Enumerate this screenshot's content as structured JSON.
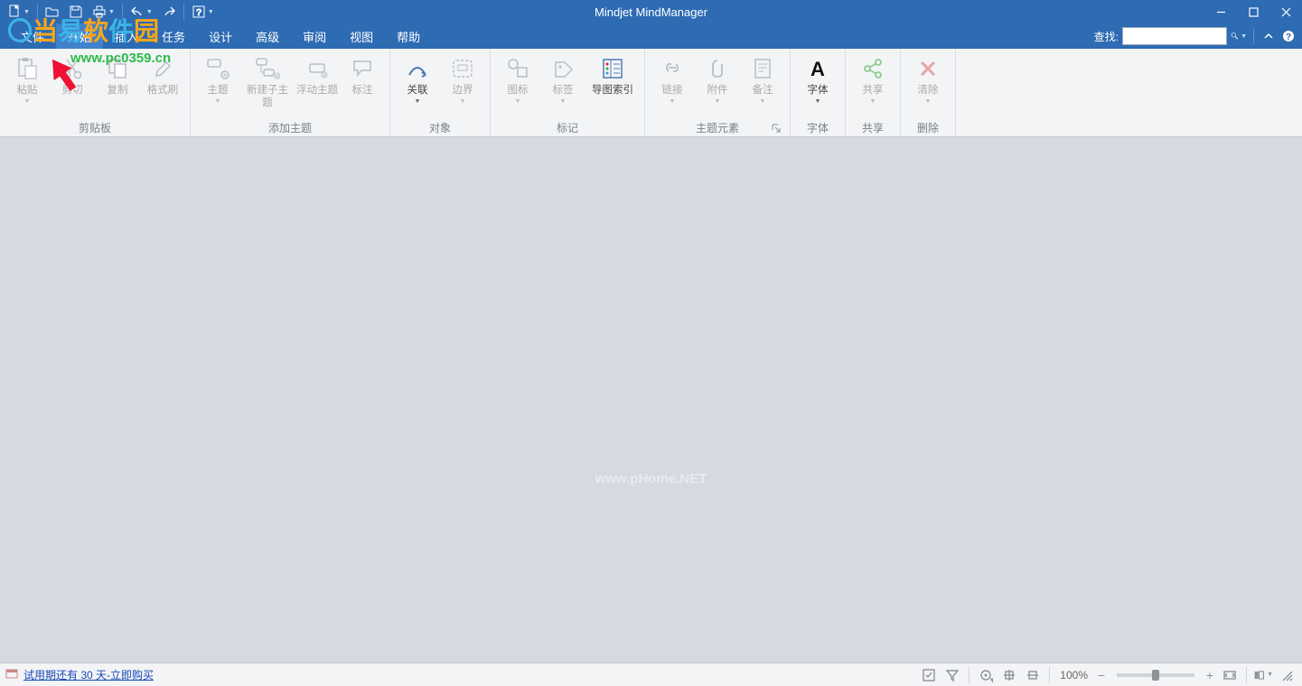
{
  "app_title": "Mindjet MindManager",
  "watermark": {
    "url": "www.pc0359.cn",
    "center": "www.pHome.NET"
  },
  "menubar": {
    "items": [
      "文件",
      "开始",
      "插入",
      "任务",
      "设计",
      "高级",
      "审阅",
      "视图",
      "帮助"
    ],
    "active_index": 1,
    "search_label": "查找:",
    "search_value": ""
  },
  "ribbon": {
    "groups": [
      {
        "label": "剪贴板",
        "buttons": [
          {
            "label": "粘贴",
            "icon": "paste",
            "enabled": false,
            "arrow": true
          },
          {
            "label": "剪切",
            "icon": "cut",
            "enabled": false,
            "arrow": false
          },
          {
            "label": "复制",
            "icon": "copy",
            "enabled": false,
            "arrow": false
          },
          {
            "label": "格式刷",
            "icon": "brush",
            "enabled": false,
            "arrow": false
          }
        ]
      },
      {
        "label": "添加主题",
        "buttons": [
          {
            "label": "主题",
            "icon": "topic",
            "enabled": false,
            "arrow": true
          },
          {
            "label": "新建子主题",
            "icon": "subtopic",
            "enabled": false,
            "arrow": false,
            "wide": true
          },
          {
            "label": "浮动主题",
            "icon": "floating",
            "enabled": false,
            "arrow": false
          },
          {
            "label": "标注",
            "icon": "callout",
            "enabled": false,
            "arrow": false
          }
        ]
      },
      {
        "label": "对象",
        "buttons": [
          {
            "label": "关联",
            "icon": "relation",
            "enabled": true,
            "arrow": true
          },
          {
            "label": "边界",
            "icon": "boundary",
            "enabled": false,
            "arrow": true
          }
        ]
      },
      {
        "label": "标记",
        "buttons": [
          {
            "label": "图标",
            "icon": "icons",
            "enabled": false,
            "arrow": true
          },
          {
            "label": "标签",
            "icon": "tags",
            "enabled": false,
            "arrow": true
          },
          {
            "label": "导图索引",
            "icon": "mapindex",
            "enabled": true,
            "arrow": false
          }
        ]
      },
      {
        "label": "主题元素",
        "launcher": true,
        "buttons": [
          {
            "label": "链接",
            "icon": "link",
            "enabled": false,
            "arrow": true
          },
          {
            "label": "附件",
            "icon": "attach",
            "enabled": false,
            "arrow": true
          },
          {
            "label": "备注",
            "icon": "notes",
            "enabled": false,
            "arrow": true
          }
        ]
      },
      {
        "label": "字体",
        "buttons": [
          {
            "label": "字体",
            "icon": "font",
            "enabled": true,
            "arrow": true,
            "dark": true
          }
        ]
      },
      {
        "label": "共享",
        "buttons": [
          {
            "label": "共享",
            "icon": "share",
            "enabled": false,
            "arrow": true,
            "green": true
          }
        ]
      },
      {
        "label": "删除",
        "buttons": [
          {
            "label": "清除",
            "icon": "clear",
            "enabled": false,
            "arrow": true,
            "red": true
          }
        ]
      }
    ]
  },
  "statusbar": {
    "trial_text": "试用期还有 30 天-立即购买",
    "zoom_percent": "100%"
  }
}
